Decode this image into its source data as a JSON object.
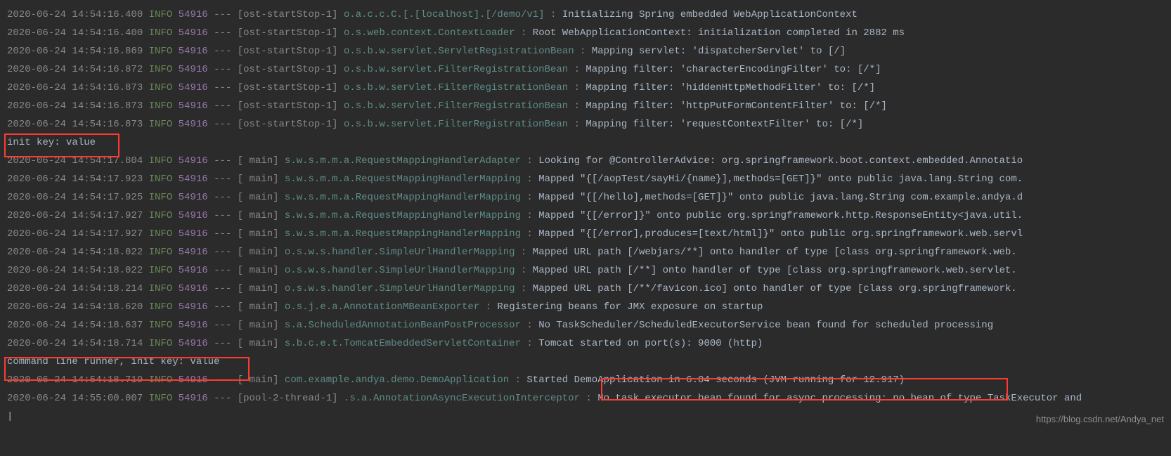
{
  "lines": [
    {
      "type": "log",
      "ts": "2020-06-24 14:54:16.400",
      "level": "INFO",
      "pid": "54916",
      "thread": "[ost-startStop-1]",
      "logger": "o.a.c.c.C.[.[localhost].[/demo/v1]     ",
      "msg": "Initializing Spring embedded WebApplicationContext"
    },
    {
      "type": "log",
      "ts": "2020-06-24 14:54:16.400",
      "level": "INFO",
      "pid": "54916",
      "thread": "[ost-startStop-1]",
      "logger": "o.s.web.context.ContextLoader          ",
      "msg": "Root WebApplicationContext: initialization completed in 2882 ms"
    },
    {
      "type": "log",
      "ts": "2020-06-24 14:54:16.869",
      "level": "INFO",
      "pid": "54916",
      "thread": "[ost-startStop-1]",
      "logger": "o.s.b.w.servlet.ServletRegistrationBean",
      "msg": "Mapping servlet: 'dispatcherServlet' to [/]"
    },
    {
      "type": "log",
      "ts": "2020-06-24 14:54:16.872",
      "level": "INFO",
      "pid": "54916",
      "thread": "[ost-startStop-1]",
      "logger": "o.s.b.w.servlet.FilterRegistrationBean ",
      "msg": "Mapping filter: 'characterEncodingFilter' to: [/*]"
    },
    {
      "type": "log",
      "ts": "2020-06-24 14:54:16.873",
      "level": "INFO",
      "pid": "54916",
      "thread": "[ost-startStop-1]",
      "logger": "o.s.b.w.servlet.FilterRegistrationBean ",
      "msg": "Mapping filter: 'hiddenHttpMethodFilter' to: [/*]"
    },
    {
      "type": "log",
      "ts": "2020-06-24 14:54:16.873",
      "level": "INFO",
      "pid": "54916",
      "thread": "[ost-startStop-1]",
      "logger": "o.s.b.w.servlet.FilterRegistrationBean ",
      "msg": "Mapping filter: 'httpPutFormContentFilter' to: [/*]"
    },
    {
      "type": "log",
      "ts": "2020-06-24 14:54:16.873",
      "level": "INFO",
      "pid": "54916",
      "thread": "[ost-startStop-1]",
      "logger": "o.s.b.w.servlet.FilterRegistrationBean ",
      "msg": "Mapping filter: 'requestContextFilter' to: [/*]"
    },
    {
      "type": "plain",
      "text": "init key: value"
    },
    {
      "type": "log",
      "ts": "2020-06-24 14:54:17.804",
      "level": "INFO",
      "pid": "54916",
      "thread": "[           main]",
      "logger": "s.w.s.m.m.a.RequestMappingHandlerAdapter",
      "msg": "Looking for @ControllerAdvice: org.springframework.boot.context.embedded.Annotatio"
    },
    {
      "type": "log",
      "ts": "2020-06-24 14:54:17.923",
      "level": "INFO",
      "pid": "54916",
      "thread": "[           main]",
      "logger": "s.w.s.m.m.a.RequestMappingHandlerMapping",
      "msg": "Mapped \"{[/aopTest/sayHi/{name}],methods=[GET]}\" onto public java.lang.String com."
    },
    {
      "type": "log",
      "ts": "2020-06-24 14:54:17.925",
      "level": "INFO",
      "pid": "54916",
      "thread": "[           main]",
      "logger": "s.w.s.m.m.a.RequestMappingHandlerMapping",
      "msg": "Mapped \"{[/hello],methods=[GET]}\" onto public java.lang.String com.example.andya.d"
    },
    {
      "type": "log",
      "ts": "2020-06-24 14:54:17.927",
      "level": "INFO",
      "pid": "54916",
      "thread": "[           main]",
      "logger": "s.w.s.m.m.a.RequestMappingHandlerMapping",
      "msg": "Mapped \"{[/error]}\" onto public org.springframework.http.ResponseEntity<java.util."
    },
    {
      "type": "log",
      "ts": "2020-06-24 14:54:17.927",
      "level": "INFO",
      "pid": "54916",
      "thread": "[           main]",
      "logger": "s.w.s.m.m.a.RequestMappingHandlerMapping",
      "msg": "Mapped \"{[/error],produces=[text/html]}\" onto public org.springframework.web.servl"
    },
    {
      "type": "log",
      "ts": "2020-06-24 14:54:18.022",
      "level": "INFO",
      "pid": "54916",
      "thread": "[           main]",
      "logger": "o.s.w.s.handler.SimpleUrlHandlerMapping ",
      "msg": "Mapped URL path [/webjars/**] onto handler of type [class org.springframework.web."
    },
    {
      "type": "log",
      "ts": "2020-06-24 14:54:18.022",
      "level": "INFO",
      "pid": "54916",
      "thread": "[           main]",
      "logger": "o.s.w.s.handler.SimpleUrlHandlerMapping ",
      "msg": "Mapped URL path [/**] onto handler of type [class org.springframework.web.servlet."
    },
    {
      "type": "log",
      "ts": "2020-06-24 14:54:18.214",
      "level": "INFO",
      "pid": "54916",
      "thread": "[           main]",
      "logger": "o.s.w.s.handler.SimpleUrlHandlerMapping ",
      "msg": "Mapped URL path [/**/favicon.ico] onto handler of type [class org.springframework."
    },
    {
      "type": "log",
      "ts": "2020-06-24 14:54:18.620",
      "level": "INFO",
      "pid": "54916",
      "thread": "[           main]",
      "logger": "o.s.j.e.a.AnnotationMBeanExporter       ",
      "msg": "Registering beans for JMX exposure on startup"
    },
    {
      "type": "log",
      "ts": "2020-06-24 14:54:18.637",
      "level": "INFO",
      "pid": "54916",
      "thread": "[           main]",
      "logger": "s.a.ScheduledAnnotationBeanPostProcessor",
      "msg": "No TaskScheduler/ScheduledExecutorService bean found for scheduled processing"
    },
    {
      "type": "log",
      "ts": "2020-06-24 14:54:18.714",
      "level": "INFO",
      "pid": "54916",
      "thread": "[           main]",
      "logger": "s.b.c.e.t.TomcatEmbeddedServletContainer",
      "msg": "Tomcat started on port(s): 9000 (http)"
    },
    {
      "type": "plain",
      "text": "command line runner, init key: value"
    },
    {
      "type": "log",
      "ts": "2020-06-24 14:54:18.719",
      "level": "INFO",
      "pid": "54916",
      "thread": "[           main]",
      "logger": "com.example.andya.demo.DemoApplication  ",
      "msg": "Started DemoApplication in 6.04 seconds (JVM running for 12.917)"
    },
    {
      "type": "log",
      "ts": "2020-06-24 14:55:00.007",
      "level": "INFO",
      "pid": "54916",
      "thread": "[pool-2-thread-1]",
      "logger": ".s.a.AnnotationAsyncExecutionInterceptor",
      "msg": "No task executor bean found for async processing: no bean of type TaskExecutor and"
    }
  ],
  "watermark": "https://blog.csdn.net/Andya_net"
}
